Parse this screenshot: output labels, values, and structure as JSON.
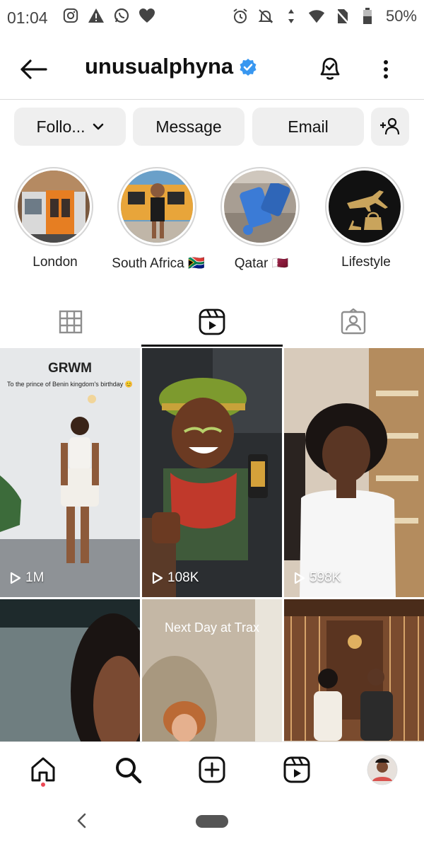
{
  "status": {
    "time": "01:04",
    "battery": "50%"
  },
  "profile": {
    "username": "unusualphyna"
  },
  "actions": {
    "follow": "Follo...",
    "message": "Message",
    "email": "Email"
  },
  "highlights": [
    {
      "label": "London"
    },
    {
      "label": "South Africa 🇿🇦"
    },
    {
      "label": "Qatar 🇶🇦"
    },
    {
      "label": "Lifestyle"
    }
  ],
  "reels": [
    {
      "title": "GRWM",
      "caption": "To the prince of Benin kingdom's birthday 😊",
      "views": "1M"
    },
    {
      "views": "108K"
    },
    {
      "views": "598K"
    },
    {
      "caption": "Next Day at Trax"
    }
  ],
  "colors": {
    "verified": "#3897f0",
    "notification_dot": "#ed4956",
    "button_bg": "#efefef"
  }
}
